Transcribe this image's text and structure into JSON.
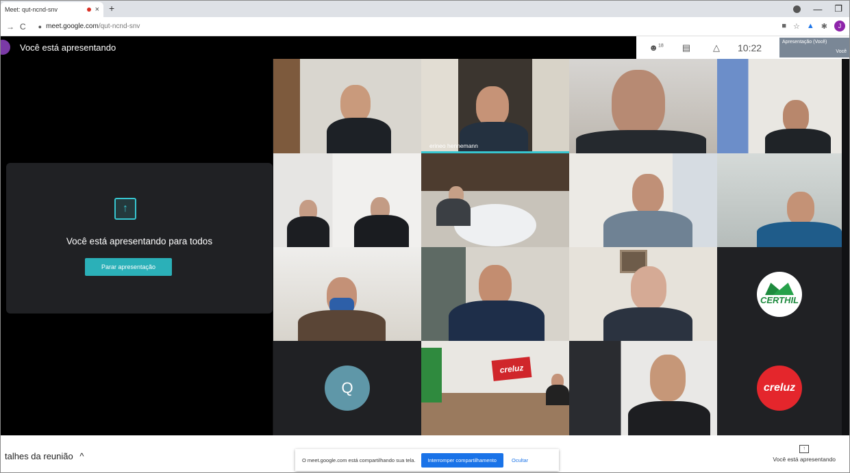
{
  "browser": {
    "tab_title": "Meet: qut-ncnd-snv",
    "tab_close": "×",
    "new_tab": "+",
    "url_host": "meet.google.com",
    "url_path": "/qut-ncnd-snv",
    "profile_initial": "J"
  },
  "meet": {
    "banner_title": "Você está apresentando",
    "people_count": "18",
    "clock": "10:22",
    "self_label": "Apresentação (Você)",
    "self_sublabel": "Você",
    "present_card": {
      "message": "Você está apresentando para todos",
      "stop_button": "Parar apresentação"
    },
    "tiles": [
      {
        "name": ""
      },
      {
        "name": "erineo hennemann"
      },
      {
        "name": ""
      },
      {
        "name": ""
      },
      {
        "name": ""
      },
      {
        "name": ""
      },
      {
        "name": ""
      },
      {
        "name": ""
      },
      {
        "name": ""
      },
      {
        "name": ""
      },
      {
        "name": ""
      },
      {
        "name": "CERTHIL"
      },
      {
        "name": "Q"
      },
      {
        "name": "creluz"
      },
      {
        "name": ""
      },
      {
        "name": "creluz"
      }
    ],
    "bottom": {
      "details": "talhes da reunião",
      "details_chevron": "^",
      "share_notice": "O meet.google.com está compartilhando sua tela.",
      "stop_sharing": "Interromper compartilhamento",
      "hide": "Ocultar",
      "presenting_label": "Você está apresentando"
    }
  },
  "colors": {
    "accent": "#37c6d0",
    "button": "#2bb0b8",
    "share_blue": "#1a73e8",
    "creluz_red": "#e4262c",
    "certhil_green": "#1e8a3e"
  }
}
